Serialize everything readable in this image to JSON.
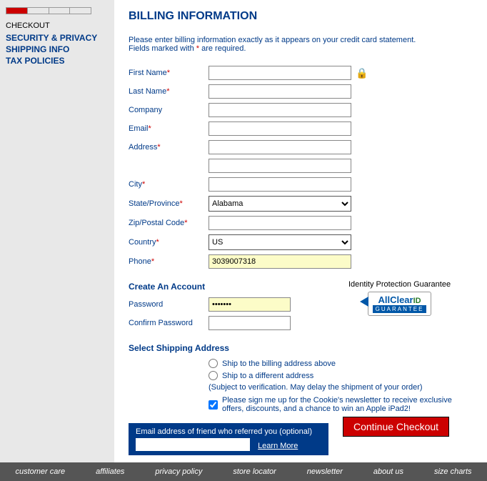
{
  "sidebar": {
    "title": "CHECKOUT",
    "links": [
      "SECURITY & PRIVACY",
      "SHIPPING INFO",
      "TAX POLICIES"
    ]
  },
  "heading": "BILLING INFORMATION",
  "intro_line1": "Please enter billing information exactly as it appears on your credit card statement.",
  "intro_line2a": "Fields marked with ",
  "intro_line2b": " are required.",
  "fields": {
    "first_name": {
      "label": "First Name",
      "req": "*",
      "value": ""
    },
    "last_name": {
      "label": "Last Name",
      "req": "*",
      "value": ""
    },
    "company": {
      "label": "Company",
      "req": "",
      "value": ""
    },
    "email": {
      "label": "Email",
      "req": "*",
      "value": ""
    },
    "address": {
      "label": "Address",
      "req": "*",
      "value": ""
    },
    "city": {
      "label": "City",
      "req": "*",
      "value": ""
    },
    "state": {
      "label": "State/Province",
      "req": "*",
      "value": "Alabama"
    },
    "zip": {
      "label": "Zip/Postal Code",
      "req": "*",
      "value": ""
    },
    "country": {
      "label": "Country",
      "req": "*",
      "value": "US"
    },
    "phone": {
      "label": "Phone",
      "req": "*",
      "value": "3039007318"
    }
  },
  "create_account_head": "Create An Account",
  "password": {
    "label": "Password",
    "value": "•••••••"
  },
  "confirm_password": {
    "label": "Confirm Password",
    "value": ""
  },
  "identity": {
    "title": "Identity Protection Guarantee",
    "brand": "AllClear",
    "sub": "GUARANTEE"
  },
  "shipping_head": "Select Shipping Address",
  "ship_billing": "Ship to the billing address above",
  "ship_different": "Ship to a different address",
  "ship_note": "(Subject to verification. May delay the shipment of your order)",
  "newsletter_text": "Please sign me up for the Cookie's newsletter to receive exclusive offers, discounts, and a chance to win an Apple iPad2!",
  "referral": {
    "label": "Email address of friend who referred you (optional)",
    "learn": "Learn More"
  },
  "continue_btn": "Continue Checkout",
  "footer": [
    "customer care",
    "affiliates",
    "privacy policy",
    "store locator",
    "newsletter",
    "about us",
    "size charts"
  ]
}
